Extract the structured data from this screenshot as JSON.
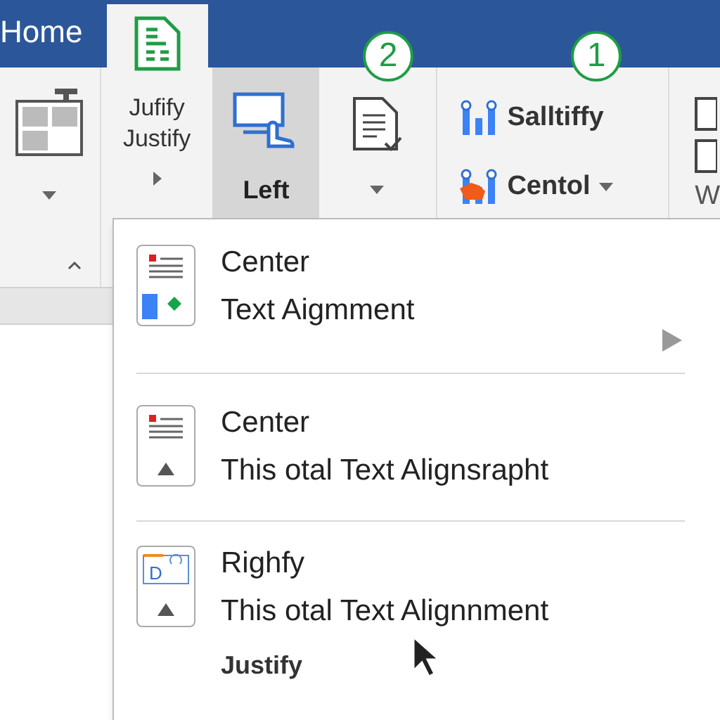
{
  "tabs": [
    {
      "kind": "text",
      "label": "Home",
      "selected": false
    },
    {
      "kind": "icon",
      "selected": true
    }
  ],
  "badges": [
    "2",
    "1"
  ],
  "ribbon": {
    "gallery": {
      "collapse": true
    },
    "justify_button": {
      "label": "Jufify Justify"
    },
    "left_button": {
      "label": "Left",
      "selected": true
    },
    "doc_button": {
      "dropdown": true
    },
    "small_buttons": [
      {
        "label": "Salltiffy",
        "dropdown": false
      },
      {
        "label": "Centol",
        "dropdown": true
      }
    ],
    "partial_button": {
      "label": "W"
    }
  },
  "menu": {
    "items": [
      {
        "kind": "shapes",
        "title": "Center",
        "subtitle": "Text Aigmment",
        "submenu": true
      },
      {
        "kind": "lines",
        "title": "Center",
        "subtitle": "This otal Text Alignsrapht",
        "submenu": false
      },
      {
        "kind": "doc",
        "icon_letter": "D",
        "title": "Righfy",
        "subtitle": "This otal Text Alignnment",
        "submenu": false
      }
    ],
    "footer": "Justify"
  }
}
